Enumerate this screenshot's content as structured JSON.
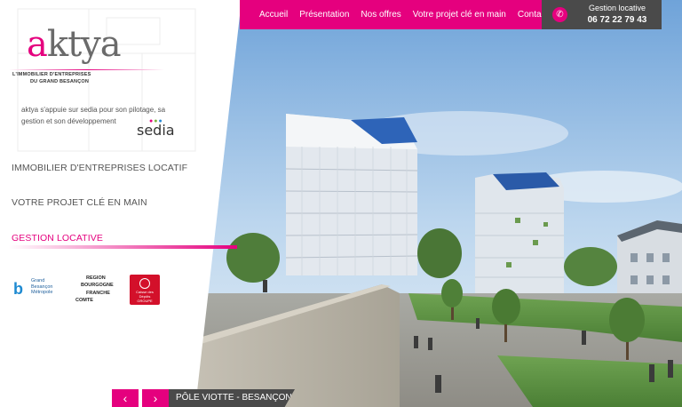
{
  "nav": {
    "items": [
      "Accueil",
      "Présentation",
      "Nos offres",
      "Votre projet clé en main",
      "Contact"
    ]
  },
  "contact": {
    "label": "Gestion locative",
    "phone": "06 72 22 79 43",
    "icon": "phone-icon"
  },
  "logo": {
    "first_letter": "a",
    "rest": "ktya",
    "tagline_1": "L'IMMOBILIER D'ENTREPRISES",
    "tagline_2": "DU GRAND BESANÇON"
  },
  "intro": {
    "text": "aktya s'appuie sur sedia pour son pilotage, sa gestion et son développement",
    "sedia": "sedia"
  },
  "menu": {
    "items": [
      "IMMOBILIER D'ENTREPRISES LOCATIF",
      "VOTRE PROJET CLÉ EN MAIN",
      "GESTION LOCATIVE"
    ]
  },
  "partners": {
    "gbm": "Grand Besançon Métropole",
    "region": [
      "REGION",
      "BOURGOGNE",
      "FRANCHE",
      "COMTE"
    ],
    "cdc": "Caisse des Dépôts GROUPE"
  },
  "slider": {
    "prev": "‹",
    "next": "›",
    "caption": "PÔLE VIOTTE - BESANÇON"
  },
  "colors": {
    "accent": "#e5007e",
    "dark": "#4a4a4a"
  }
}
